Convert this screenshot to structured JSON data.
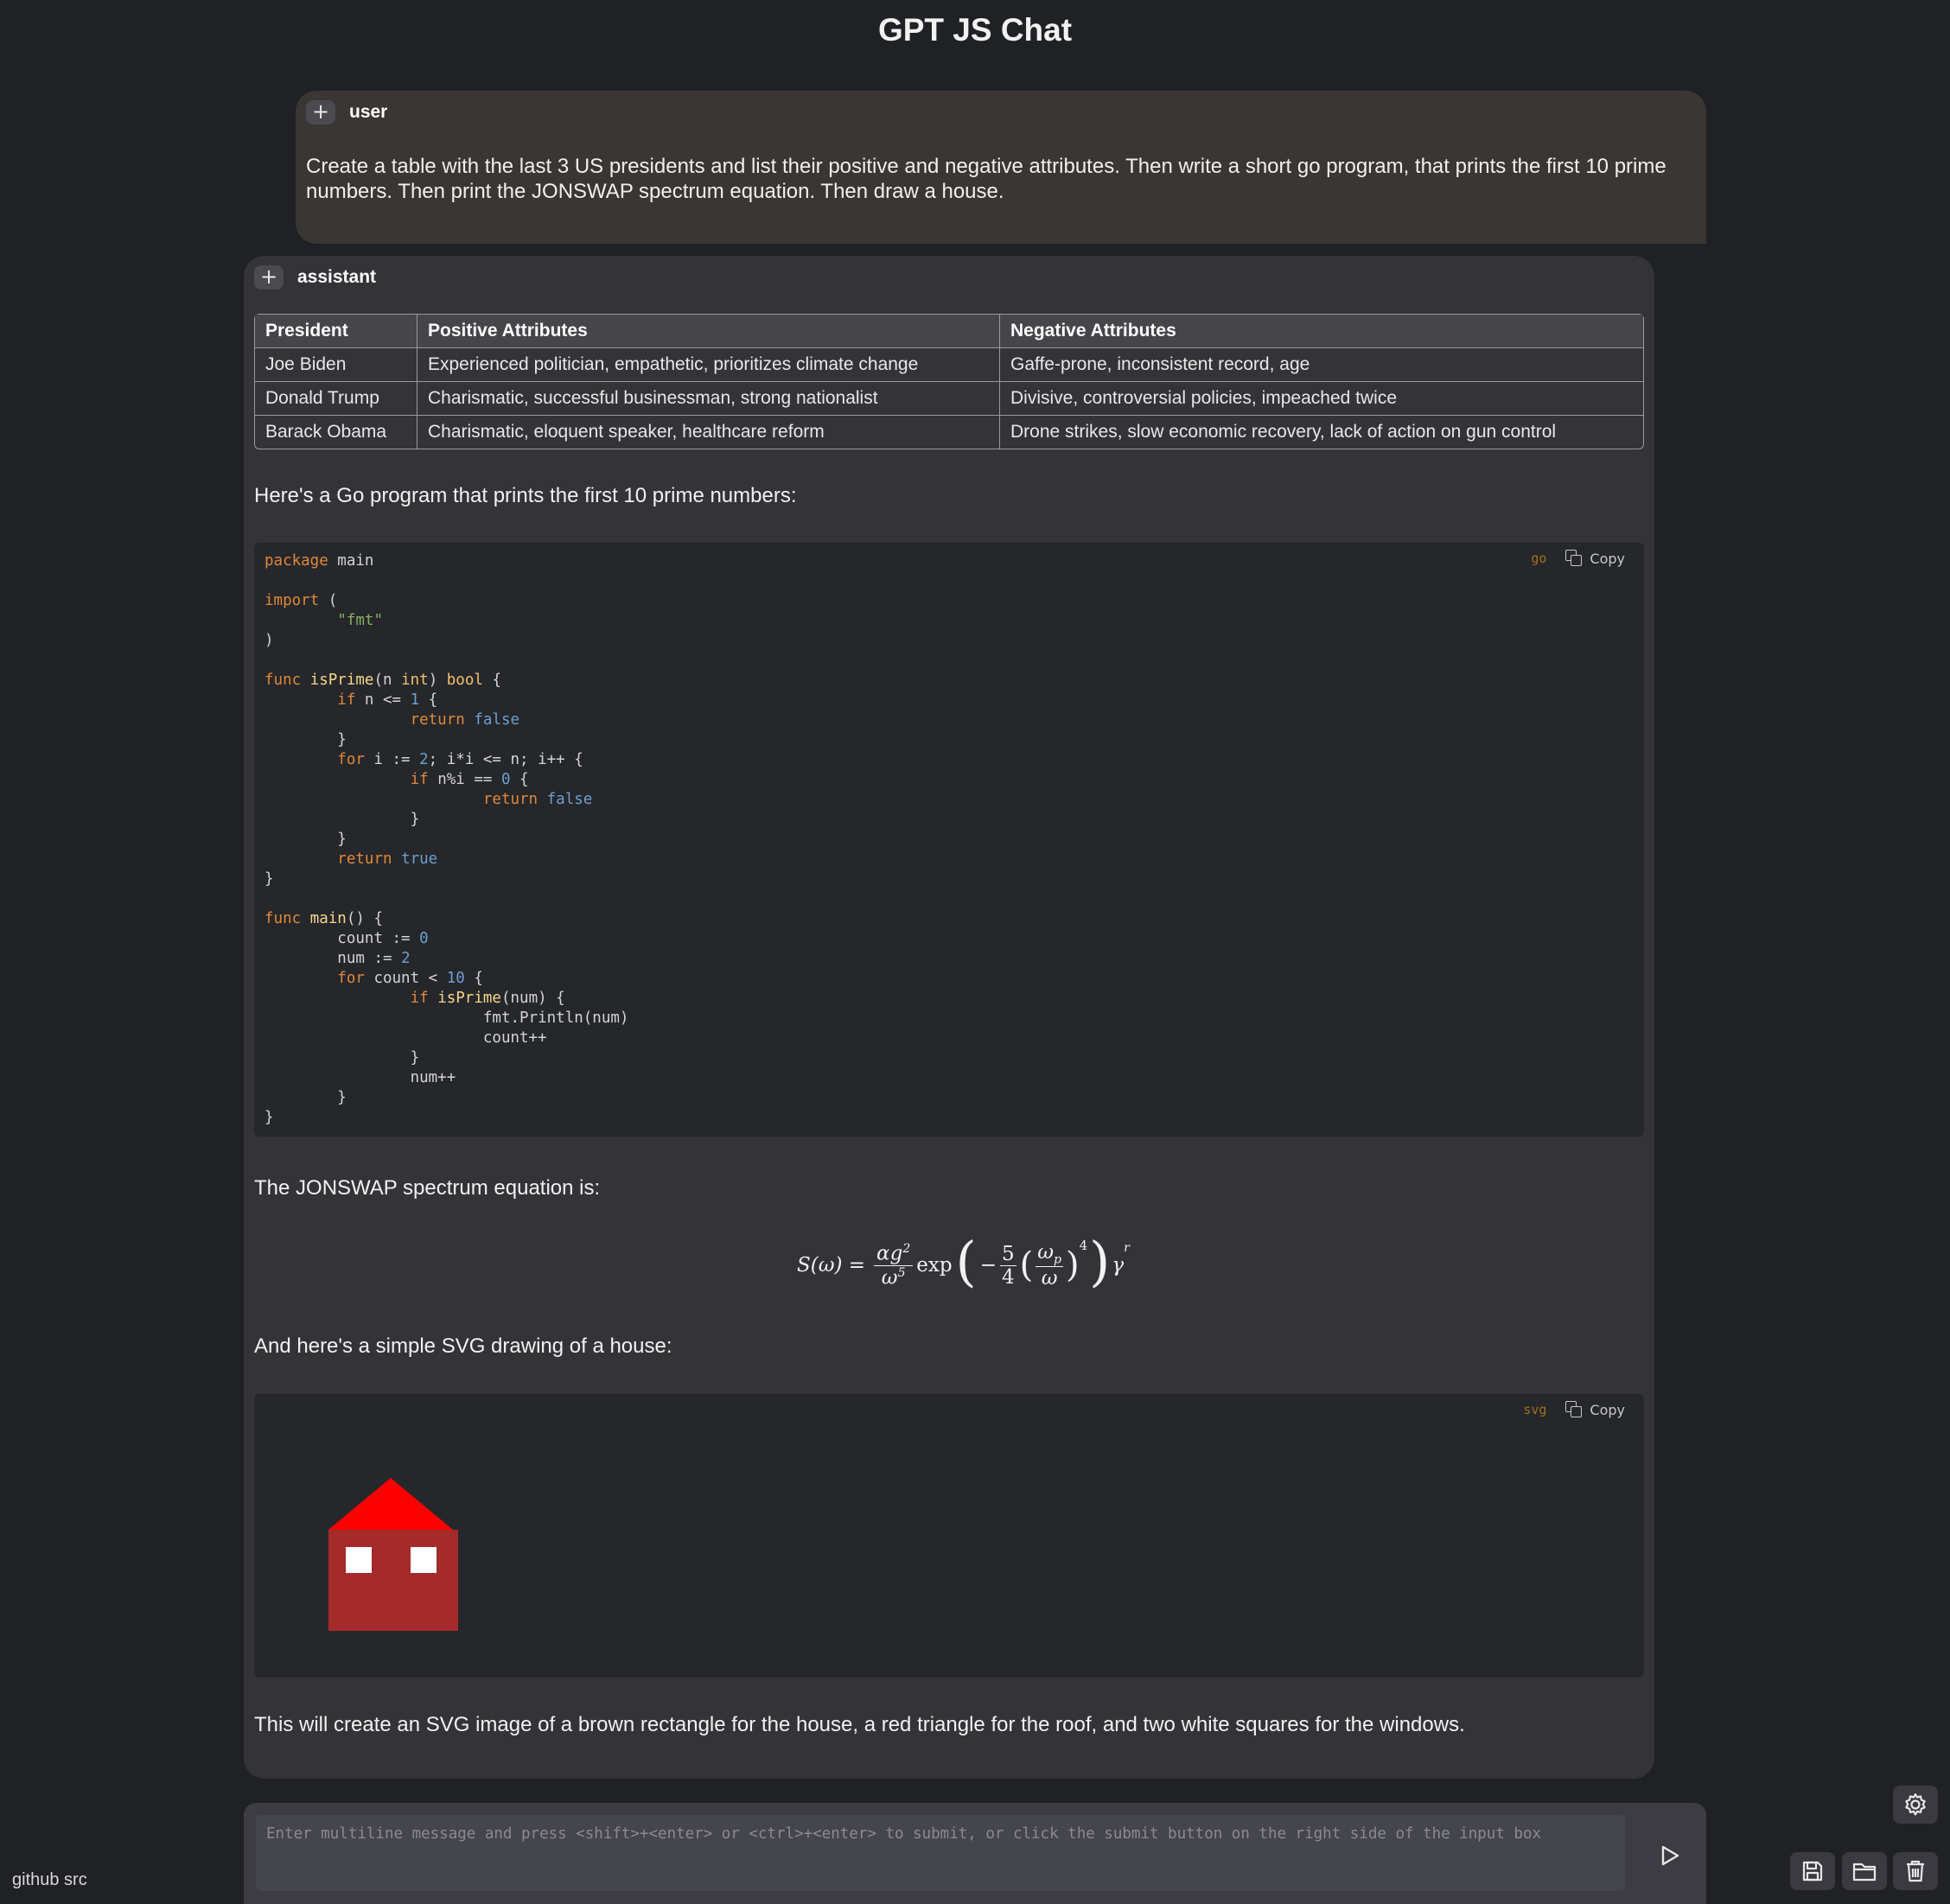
{
  "app": {
    "title": "GPT JS Chat"
  },
  "messages": {
    "user": {
      "add_symbol": "+",
      "role": "user",
      "text": "Create a table with the last 3 US presidents and list their positive and negative attributes. Then write a short go program, that prints the first 10 prime numbers. Then print the JONSWAP spectrum equation. Then draw a house."
    },
    "assistant": {
      "add_symbol": "+",
      "role": "assistant",
      "table": {
        "headers": [
          "President",
          "Positive Attributes",
          "Negative Attributes"
        ],
        "rows": [
          [
            "Joe Biden",
            "Experienced politician, empathetic, prioritizes climate change",
            "Gaffe-prone, inconsistent record, age"
          ],
          [
            "Donald Trump",
            "Charismatic, successful businessman, strong nationalist",
            "Divisive, controversial policies, impeached twice"
          ],
          [
            "Barack Obama",
            "Charismatic, eloquent speaker, healthcare reform",
            "Drone strikes, slow economic recovery, lack of action on gun control"
          ]
        ]
      },
      "intro_code": "Here's a Go program that prints the first 10 prime numbers:",
      "code_block": {
        "language": "go",
        "copy_label": "Copy",
        "code": "package main\n\nimport (\n\t\"fmt\"\n)\n\nfunc isPrime(n int) bool {\n\tif n <= 1 {\n\t\treturn false\n\t}\n\tfor i := 2; i*i <= n; i++ {\n\t\tif n%i == 0 {\n\t\t\treturn false\n\t\t}\n\t}\n\treturn true\n}\n\nfunc main() {\n\tcount := 0\n\tnum := 2\n\tfor count < 10 {\n\t\tif isPrime(num) {\n\t\t\tfmt.Println(num)\n\t\t\tcount++\n\t\t}\n\t\tnum++\n\t}\n}"
      },
      "intro_equation": "The JONSWAP spectrum equation is:",
      "equation": {
        "lhs": "S(ω) =",
        "numerator": "αg",
        "numerator_exp": "2",
        "denominator": "ω",
        "denominator_exp": "5",
        "exp_word": "exp",
        "minus": "−",
        "frac_num": "5",
        "frac_den": "4",
        "inner_num": "ω",
        "inner_num_sub": "p",
        "inner_den": "ω",
        "power": "4",
        "gamma": "γ",
        "gamma_exp": "r"
      },
      "intro_svg": "And here's a simple SVG drawing of a house:",
      "svg_block": {
        "language": "svg",
        "copy_label": "Copy",
        "colors": {
          "wall": "#a52a2a",
          "roof": "#ff0000",
          "window": "#ffffff"
        }
      },
      "closing": "This will create an SVG image of a brown rectangle for the house, a red triangle for the roof, and two white squares for the windows."
    }
  },
  "input": {
    "placeholder": "Enter multiline message and press <shift>+<enter> or <ctrl>+<enter> to submit, or click the submit button on the right side of the input box",
    "value": ""
  },
  "footer": {
    "github_link": "github src"
  },
  "icons": {
    "submit": "play-triangle-icon",
    "settings": "gear-icon",
    "save": "floppy-disk-icon",
    "open": "folder-icon",
    "delete": "trash-icon"
  },
  "theme": {
    "background": "#202124",
    "user_bubble": "#3a3634",
    "assistant_bubble": "#343438",
    "code_bg": "#25272b"
  }
}
